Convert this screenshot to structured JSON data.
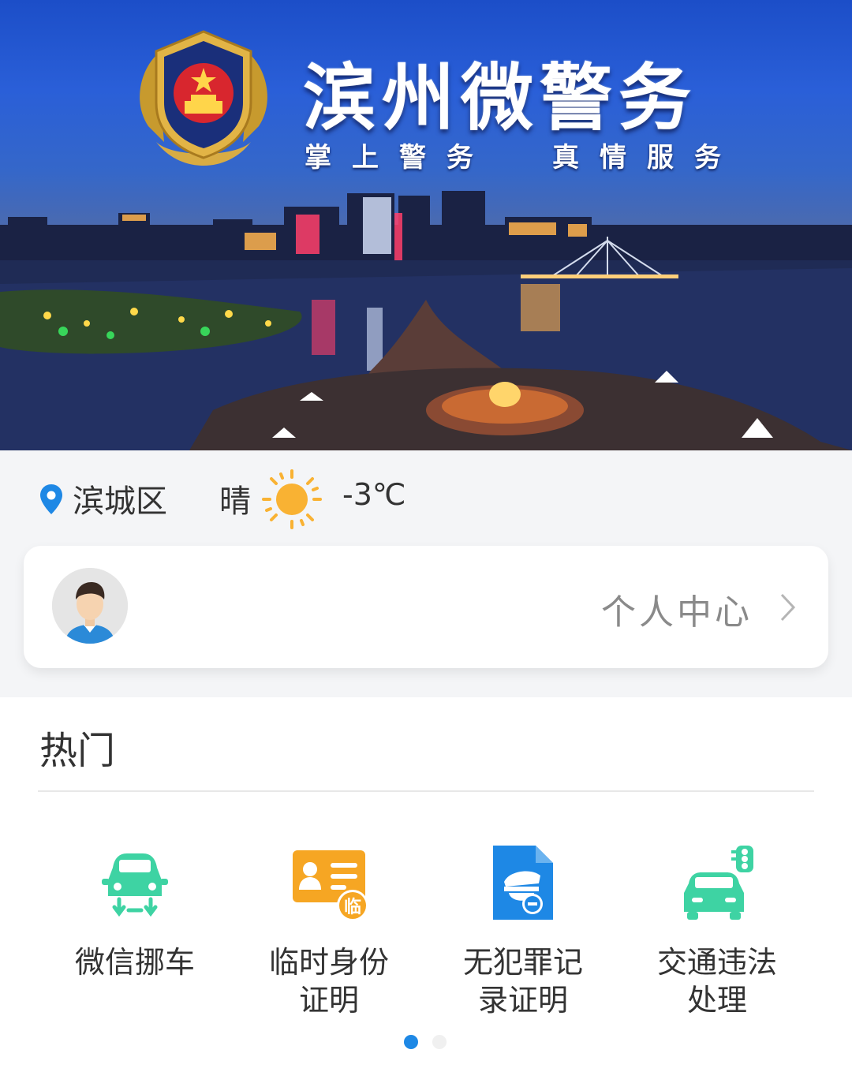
{
  "banner": {
    "title": "滨州微警务",
    "subtitle_left": "掌上警务",
    "subtitle_right": "真情服务",
    "emblem_icon": "police-emblem-icon"
  },
  "location": {
    "district": "滨城区",
    "icon": "location-pin-icon",
    "icon_color": "#1e88e5"
  },
  "weather": {
    "condition": "晴",
    "icon": "sun-icon",
    "temperature": "-3℃"
  },
  "profile": {
    "label": "个人中心",
    "avatar_icon": "avatar-icon"
  },
  "hot": {
    "title": "热门",
    "services": [
      {
        "label": "微信挪车",
        "icon": "car-tow-icon",
        "color": "#3ed3a3"
      },
      {
        "label": "临时身份证明",
        "icon": "temp-id-card-icon",
        "color": "#f6a623"
      },
      {
        "label": "无犯罪记录证明",
        "icon": "no-criminal-record-icon",
        "color": "#1e88e5"
      },
      {
        "label": "交通违法处理",
        "icon": "traffic-violation-icon",
        "color": "#3ed3a3"
      }
    ],
    "pager": {
      "pages": 2,
      "active": 1
    }
  }
}
